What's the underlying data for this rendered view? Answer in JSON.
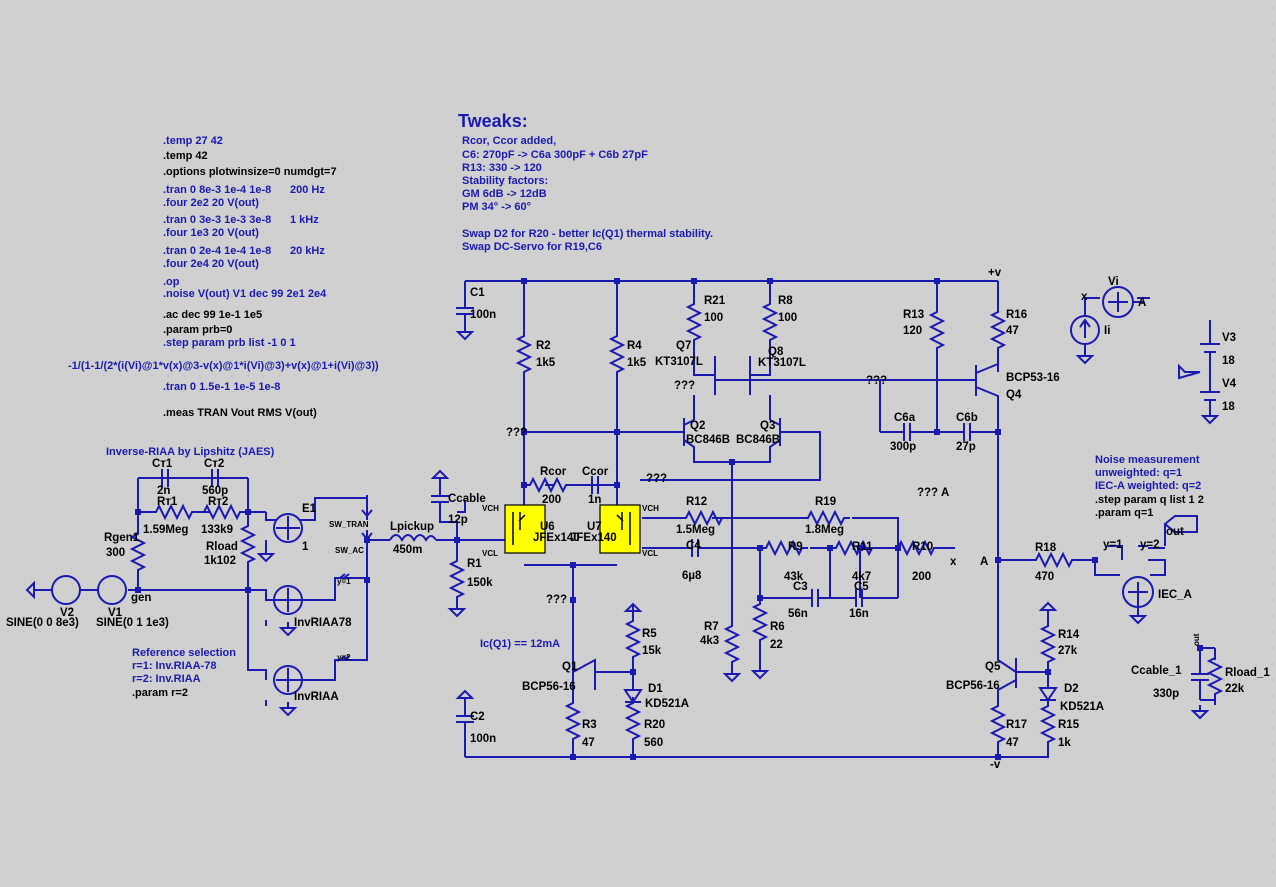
{
  "directives": [
    ".temp 27 42",
    ".temp 42",
    ".options plotwinsize=0 numdgt=7",
    ".tran 0 8e-3 1e-4 1e-8",
    "200 Hz",
    ".four 2e2 20 V(out)",
    ".tran 0 3e-3 1e-3 3e-8",
    "1 kHz",
    ".four 1e3 20 V(out)",
    ".tran 0 2e-4 1e-4 1e-8",
    "20 kHz",
    ".four 2e4 20 V(out)",
    ".op",
    ".noise V(out) V1 dec 99 2e1 2e4",
    ".ac dec 99 1e-1 1e5",
    ".param prb=0",
    ".step param prb list -1 0 1",
    "-1/(1-1/(2*(i(Vi)@1*v(x)@3-v(x)@1*i(Vi)@3)+v(x)@1+i(Vi)@3))",
    ".tran 0 1.5e-1 1e-5 1e-8",
    ".meas TRAN Vout RMS V(out)"
  ],
  "tweaks": {
    "title": "Tweaks:",
    "lines": [
      "Rcor, Ccor added,",
      "C6: 270pF -> C6a 300pF + C6b 27pF",
      "R13: 330 -> 120",
      "Stability factors:",
      "GM 6dB -> 12dB",
      "PM 34° -> 60°",
      "",
      "Swap D2 for R20 - better Ic(Q1) thermal stability.",
      "Swap DC-Servo for R19,C6"
    ]
  },
  "riaa_title": "Inverse-RIAA by Lipshitz (JAES)",
  "reference": [
    "Reference selection",
    "r=1: Inv.RIAA-78",
    "r=2: Inv.RIAA",
    ".param r=2"
  ],
  "noise": [
    "Noise measurement",
    "unweighted: q=1",
    "IEC-A weighted: q=2",
    ".step param q list 1 2",
    ".param q=1"
  ],
  "ic_note": "Ic(Q1) == 12mA",
  "labels": {
    "C1": "C1",
    "C1v": "100n",
    "C2": "C2",
    "C2v": "100n",
    "R2": "R2",
    "R2v": "1k5",
    "R4": "R4",
    "R4v": "1k5",
    "R21": "R21",
    "R21v": "100",
    "R8": "R8",
    "R8v": "100",
    "Q7": "Q7",
    "Q7v": "KT3107L",
    "Q8": "Q8",
    "Q8v": "KT3107L",
    "Q2": "Q2",
    "Q2v": "BC846B",
    "Q3": "Q3",
    "Q3v": "BC846B",
    "R13": "R13",
    "R13v": "120",
    "R16": "R16",
    "R16v": "47",
    "Q4v": "BCP53-16",
    "Q4": "Q4",
    "C6a": "C6a",
    "C6av": "300p",
    "C6b": "C6b",
    "C6bv": "27p",
    "Rcor": "Rcor",
    "Rcorv": "200",
    "Ccor": "Ccor",
    "Ccorv": "1n",
    "U6": "U6",
    "U6v": "JFEx140",
    "U7": "U7",
    "U7v": "JFEx140",
    "R12": "R12",
    "R12v": "1.5Meg",
    "R19": "R19",
    "R19v": "1.8Meg",
    "C4": "C4",
    "C4v": "6µ8",
    "R9": "R9",
    "R9v": "43k",
    "R11": "R11",
    "R11v": "4k7",
    "C3": "C3",
    "C3v": "56n",
    "C5": "C5",
    "C5v": "16n",
    "R10": "R10",
    "R10v": "200",
    "R7": "R7",
    "R7v": "4k3",
    "R6": "R6",
    "R6v": "22",
    "R5": "R5",
    "R5v": "15k",
    "D1": "D1",
    "D1v": "KD521A",
    "R20": "R20",
    "R20v": "560",
    "Q1": "Q1",
    "Q1v": "BCP56-16",
    "R3": "R3",
    "R3v": "47",
    "R18": "R18",
    "R18v": "470",
    "R14": "R14",
    "R14v": "27k",
    "D2": "D2",
    "D2v": "KD521A",
    "Q5": "Q5",
    "Q5v": "BCP56-16",
    "R17": "R17",
    "R17v": "47",
    "R15": "R15",
    "R15v": "1k",
    "V3": "V3",
    "V3v": "18",
    "V4": "V4",
    "V4v": "18",
    "Vi": "Vi",
    "Ii": "Ii",
    "Ccable": "Ccable",
    "Ccablev": "12p",
    "Lpickup": "Lpickup",
    "Lpickupv": "450m",
    "R1": "R1",
    "R1v": "150k",
    "Ct1": "Cт1",
    "Ct1v": "2n",
    "Ct2": "Cт2",
    "Ct2v": "560p",
    "Rt1": "Rт1",
    "Rt1v": "1.59Meg",
    "Rt2": "Rт2",
    "Rt2v": "133k9",
    "Rgen1": "Rgen1",
    "Rgen1v": "300",
    "Rload": "Rload",
    "Rloadv": "1k102",
    "E1": "E1",
    "E1v": "1",
    "V1": "V1",
    "V1v": "SINE(0 1 1e3)",
    "V2": "V2",
    "V2v": "SINE(0 0 8e3)",
    "gen": "gen",
    "InvRIAA78": "InvRIAA78",
    "InvRIAA": "InvRIAA",
    "sw_tran": "SW_TRAN",
    "sw_ac": "SW_AC",
    "y1": "y=1",
    "y2": "y=2",
    "iec": "IEC_A",
    "out": "out",
    "Ccable1": "Ccable_1",
    "Ccable1v": "330p",
    "Rload1": "Rload_1",
    "Rload1v": "22k",
    "pv": "+v",
    "mv": "-v",
    "A": "A",
    "A2": "A",
    "x": "x",
    "x2": "x",
    "qqq": "???",
    "vch": "VCH",
    "vcl": "VCL"
  }
}
